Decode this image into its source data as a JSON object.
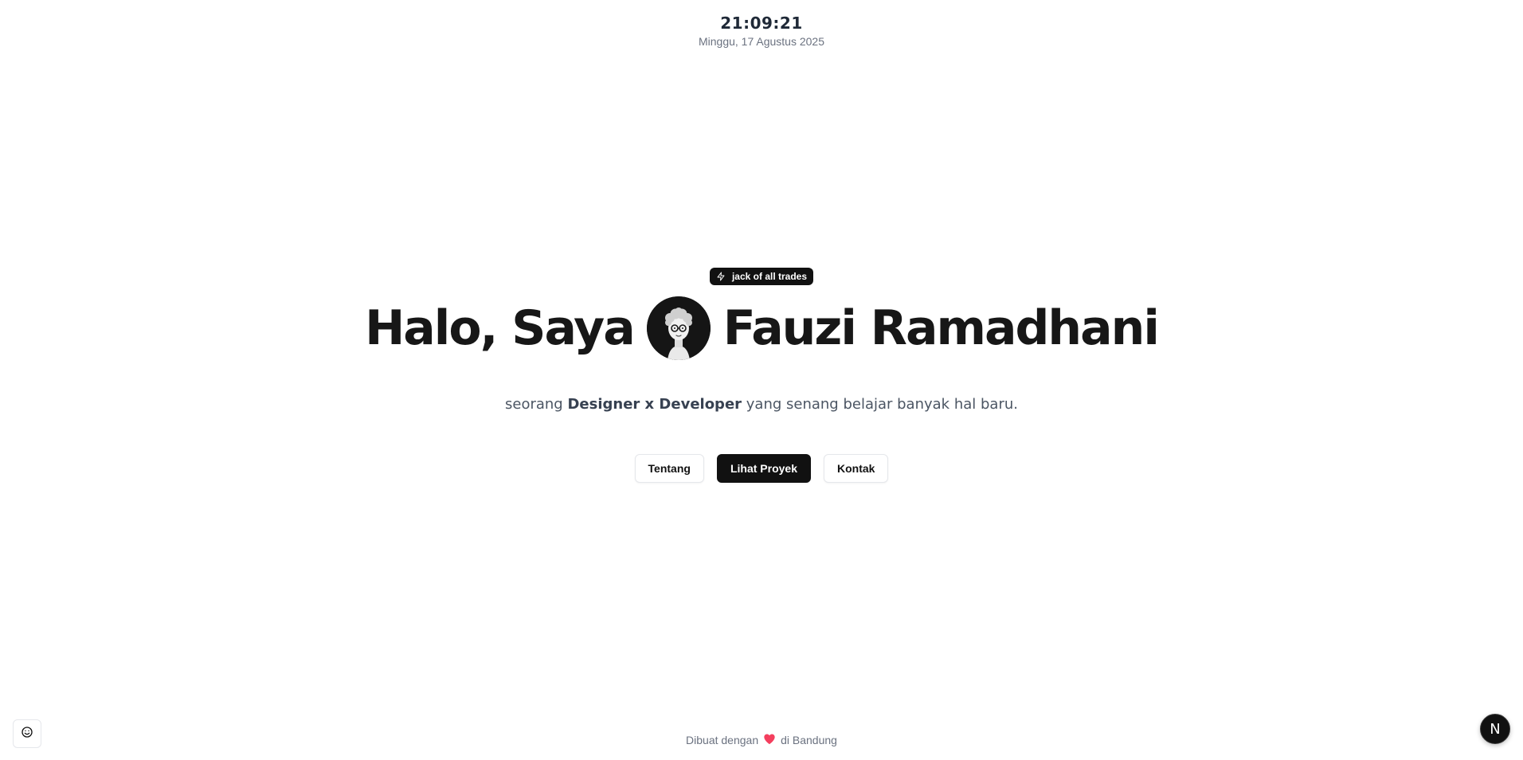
{
  "clock": {
    "time": "21:09:21",
    "date": "Minggu, 17 Agustus 2025"
  },
  "badge": {
    "icon": "zap-icon",
    "label": "jack of all trades"
  },
  "headline": {
    "greeting": "Halo, Saya",
    "name": "Fauzi Ramadhani",
    "avatar_icon": "avatar-illustration"
  },
  "tagline": {
    "prefix": "seorang",
    "highlight": "Designer x Developer",
    "suffix": "yang senang belajar banyak hal baru."
  },
  "actions": {
    "about_label": "Tentang",
    "projects_label": "Lihat Proyek",
    "contact_label": "Kontak"
  },
  "footer": {
    "prefix": "Dibuat dengan",
    "heart_icon": "heart-icon",
    "suffix": "di Bandung"
  },
  "corner": {
    "left_icon": "smile-icon",
    "right_label": "N"
  },
  "colors": {
    "primary": "#111111",
    "heart": "#f43f5e",
    "muted": "#6b7280"
  }
}
